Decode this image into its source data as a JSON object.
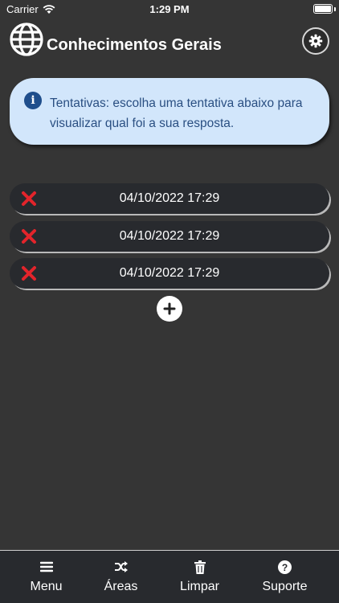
{
  "status_bar": {
    "carrier": "Carrier",
    "time": "1:29 PM"
  },
  "header": {
    "title": "Conhecimentos Gerais",
    "settings_icon": "gear-icon",
    "logo_icon": "globe-icon"
  },
  "info": {
    "text": "Tentativas: escolha uma tentativa abaixo para visualizar qual foi a sua resposta.",
    "icon": "info-icon"
  },
  "attempts": [
    {
      "date": "04/10/2022 17:29",
      "status": "incorrect"
    },
    {
      "date": "04/10/2022 17:29",
      "status": "incorrect"
    },
    {
      "date": "04/10/2022 17:29",
      "status": "incorrect"
    }
  ],
  "add_button": {
    "icon": "plus-icon"
  },
  "tabs": [
    {
      "label": "Menu",
      "icon": "menu-icon"
    },
    {
      "label": "Áreas",
      "icon": "shuffle-icon"
    },
    {
      "label": "Limpar",
      "icon": "trash-icon"
    },
    {
      "label": "Suporte",
      "icon": "help-icon"
    }
  ],
  "colors": {
    "background": "#353535",
    "card": "#282a2e",
    "info_bg": "#d2e6fb",
    "info_text": "#2a4f82",
    "error_red": "#e3242b"
  }
}
